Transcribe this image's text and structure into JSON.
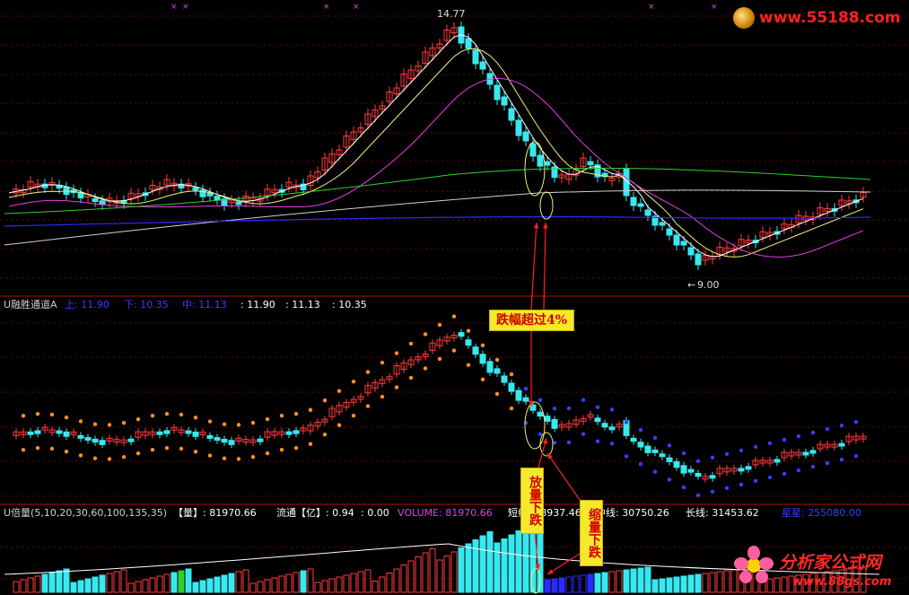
{
  "price_panel": {
    "high_label": "14.77",
    "low_label": "9.00",
    "colors": {
      "up": "#ff3c3c",
      "down": "#38e8f0",
      "ma1": "#ffffff",
      "ma2": "#f0f07a",
      "ma3": "#e040e0",
      "ma4": "#30d030",
      "ma5": "#d0d0d0",
      "ma6": "#2b2bff"
    }
  },
  "channel_panel": {
    "name": "U融胜通道A",
    "up": "上: 11.90",
    "down": "下: 10.35",
    "mid": "中: 11.13",
    "v1": ": 11.90",
    "v2": ": 11.13",
    "v3": ": 10.35"
  },
  "volume_panel": {
    "name": "U倍量(5,10,20,30,60,100,135,35)",
    "vol": "【量】: 81970.66",
    "flow": "流通【亿】: 0.94",
    "zero": ": 0.00",
    "volume": "VOLUME: 81970.66",
    "short": "短线: 28937.46",
    "mid": "中线: 30750.26",
    "long": "长线: 31453.62",
    "star": "星星: 255080.00"
  },
  "annotations": {
    "drop": "跌幅超过4%",
    "expand": "放量下跌",
    "shrink": "缩量下跌"
  },
  "watermarks": {
    "top": "www.55188.com",
    "bottom_cn": "分析家公式网",
    "bottom_url": "www.88gs.com"
  }
}
